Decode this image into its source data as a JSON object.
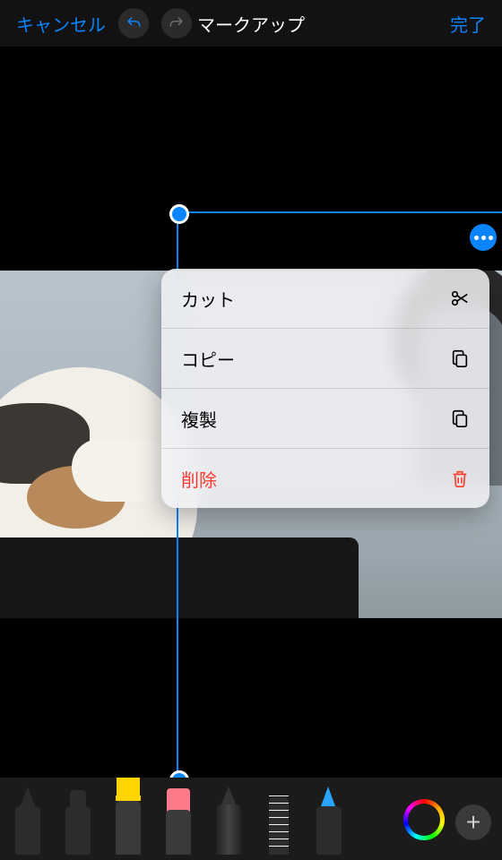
{
  "topbar": {
    "cancel": "キャンセル",
    "title": "マークアップ",
    "done": "完了"
  },
  "popup": {
    "cut": "カット",
    "copy": "コピー",
    "duplicate": "複製",
    "delete": "削除"
  },
  "tools": {
    "pen_fine": "fine-pen",
    "pen_marker": "marker-pen",
    "highlighter": "highlighter",
    "eraser": "eraser",
    "pencil": "pencil",
    "ruler": "ruler",
    "pen_blue": "blue-pen",
    "selected": "highlighter",
    "color": "#ffd400"
  }
}
